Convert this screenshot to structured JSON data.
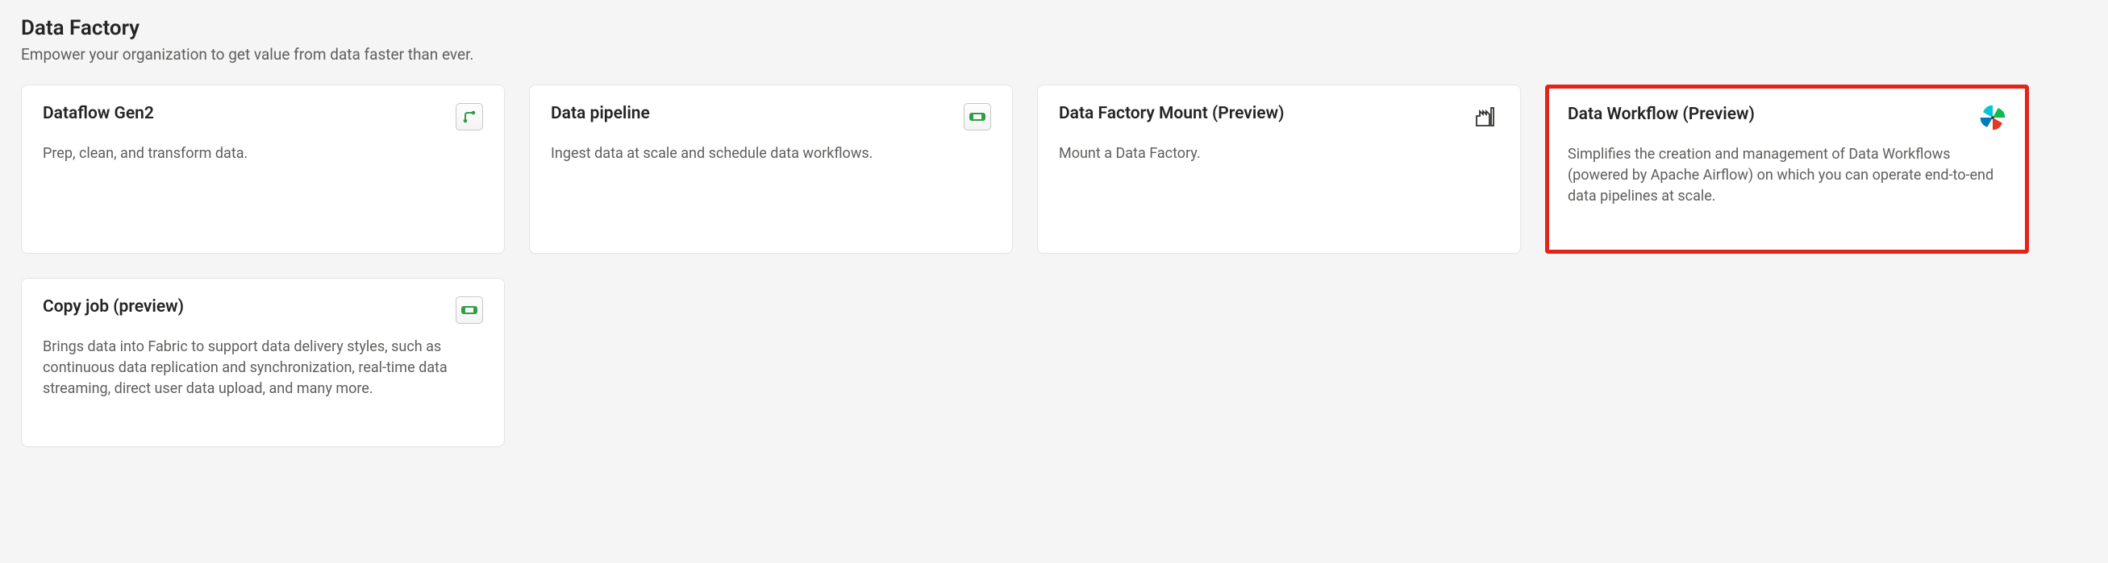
{
  "header": {
    "title": "Data Factory",
    "subtitle": "Empower your organization to get value from data faster than ever."
  },
  "cards": [
    {
      "title": "Dataflow Gen2",
      "desc": "Prep, clean, and transform data.",
      "icon": "diagram-icon",
      "highlighted": false
    },
    {
      "title": "Data pipeline",
      "desc": "Ingest data at scale and schedule data workflows.",
      "icon": "pipeline-icon",
      "highlighted": false
    },
    {
      "title": "Data Factory Mount (Preview)",
      "desc": "Mount a Data Factory.",
      "icon": "factory-icon",
      "highlighted": false
    },
    {
      "title": "Data Workflow (Preview)",
      "desc": "Simplifies the creation and management of Data Workflows (powered by Apache Airflow) on which you can operate end-to-end data pipelines at scale.",
      "icon": "airflow-icon",
      "highlighted": true
    },
    {
      "title": "Copy job (preview)",
      "desc": "Brings data into Fabric to support data delivery styles, such as continuous data replication and synchronization, real-time data streaming, direct user data upload, and many more.",
      "icon": "pipeline-icon",
      "highlighted": false
    }
  ]
}
